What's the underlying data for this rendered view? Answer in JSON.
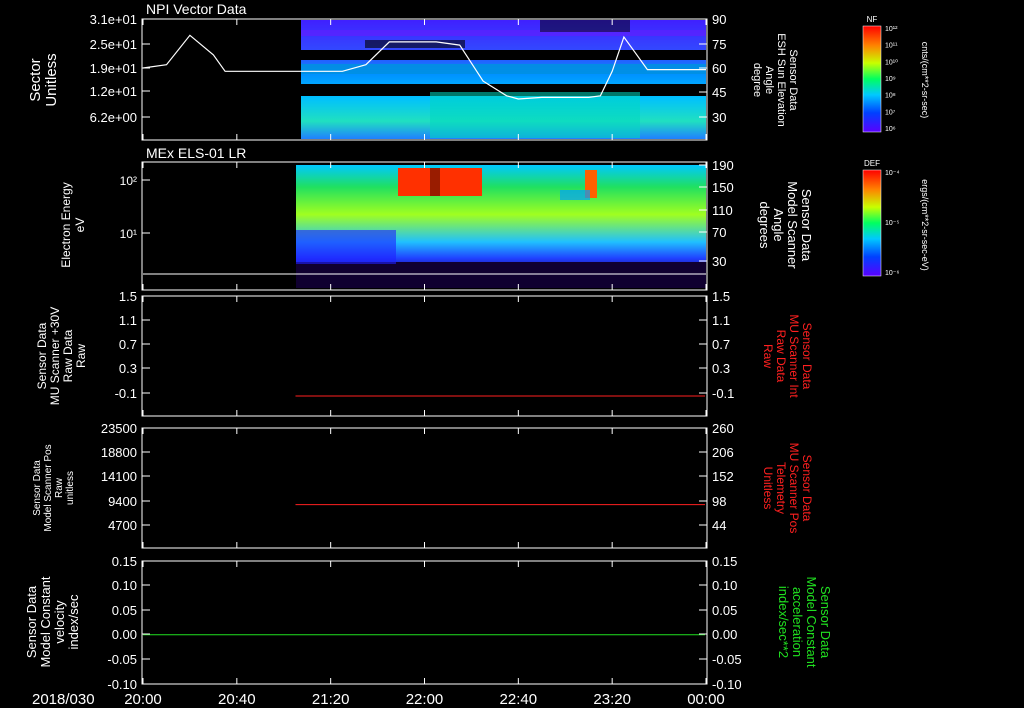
{
  "x_axis": {
    "date_label": "2018/030",
    "tick_labels": [
      "20:00",
      "20:40",
      "21:20",
      "22:00",
      "22:40",
      "23:20",
      "00:00"
    ]
  },
  "colors": {
    "white": "#ffffff",
    "red": "#ff2020",
    "green": "#20e020"
  },
  "panels": [
    {
      "title": "NPI Vector Data",
      "left_label": [
        "Sector",
        "Unitless"
      ],
      "left_ticks": [
        "3.1e+01",
        "2.5e+01",
        "1.9e+01",
        "1.2e+01",
        "6.2e+00"
      ],
      "right_label": [
        "Sensor Data",
        "ESH Sun Elevation",
        "Angle",
        "degree"
      ],
      "right_ticks": [
        "90",
        "75",
        "60",
        "45",
        "30"
      ],
      "colorbar": {
        "label": "NF",
        "units": "cnts/(cm**2-sr-sec)",
        "ticks": [
          "10¹²",
          "10¹¹",
          "10¹⁰",
          "10⁹",
          "10⁸",
          "10⁷",
          "10⁶"
        ]
      }
    },
    {
      "title": "MEx ELS-01 LR",
      "left_label": [
        "Electron Energy",
        "eV"
      ],
      "left_ticks": [
        "10²",
        "10¹"
      ],
      "right_label": [
        "Sensor Data",
        "Model Scanner",
        "Angle",
        "degrees"
      ],
      "right_ticks": [
        "190",
        "150",
        "110",
        "70",
        "30"
      ],
      "colorbar": {
        "label": "DEF",
        "units": "ergs/(cm**2-sr-sec-eV)",
        "ticks": [
          "10⁻⁴",
          "10⁻⁵",
          "10⁻⁶"
        ]
      }
    },
    {
      "left_label": [
        "Sensor Data",
        "MU Scanner +30V",
        "Raw Data",
        "Raw"
      ],
      "left_ticks": [
        "1.5",
        "1.1",
        "0.7",
        "0.3",
        "-0.1"
      ],
      "right_label": [
        "Sensor Data",
        "MU Scanner Int",
        "Raw Data",
        "Raw"
      ],
      "right_ticks": [
        "1.5",
        "1.1",
        "0.7",
        "0.3",
        "-0.1"
      ]
    },
    {
      "left_label": [
        "Sensor Data",
        "Model Scanner Pos",
        "Raw",
        "unitless"
      ],
      "left_ticks": [
        "23500",
        "18800",
        "14100",
        "9400",
        "4700"
      ],
      "right_label": [
        "Sensor Data",
        "MU Scanner Pos",
        "Telemetry",
        "Unitless"
      ],
      "right_ticks": [
        "260",
        "206",
        "152",
        "98",
        "44"
      ]
    },
    {
      "left_label": [
        "Sensor Data",
        "Model Constant",
        "velocity",
        "index/sec"
      ],
      "left_ticks": [
        "0.15",
        "0.10",
        "0.05",
        "0.00",
        "-0.05",
        "-0.10"
      ],
      "right_label": [
        "Sensor Data",
        "Model Constant",
        "acceleration",
        "index/sec**2"
      ],
      "right_ticks": [
        "0.15",
        "0.10",
        "0.05",
        "0.00",
        "-0.05",
        "-0.10"
      ]
    }
  ],
  "chart_data": [
    {
      "type": "heatmap",
      "title": "NPI Vector Data",
      "x_range": [
        "20:00",
        "00:00"
      ],
      "ylabel": "Sector Unitless",
      "y_ticks": [
        "3.1e+01",
        "2.5e+01",
        "1.9e+01",
        "1.2e+01",
        "6.2e+00"
      ],
      "data_start": "21:10",
      "overlay_line": {
        "label": "Sensor Data ESH Sun Elevation Angle degree",
        "x": [
          "20:00",
          "20:10",
          "20:20",
          "20:30",
          "20:35",
          "20:45",
          "20:55",
          "21:10",
          "21:25",
          "21:35",
          "21:45",
          "21:55",
          "22:05",
          "22:15",
          "22:25",
          "22:35",
          "22:40",
          "22:50",
          "23:00",
          "23:10",
          "23:15",
          "23:20",
          "23:25",
          "23:35",
          "00:00"
        ],
        "y": [
          60,
          62,
          80,
          68,
          58,
          58,
          58,
          58,
          58,
          62,
          76,
          76,
          76,
          74,
          52,
          43,
          41,
          42,
          42,
          42,
          43,
          58,
          79,
          59,
          59
        ]
      }
    },
    {
      "type": "heatmap",
      "title": "MEx ELS-01 LR",
      "x_range": [
        "20:00",
        "00:00"
      ],
      "ylabel": "Electron Energy eV",
      "data_start": "21:07",
      "overlay_line": {
        "label": "Sensor Data Model Scanner Angle degrees",
        "x": [
          "20:00",
          "00:00"
        ],
        "y": [
          10,
          10
        ]
      }
    },
    {
      "type": "line",
      "x_range": [
        "20:00",
        "00:00"
      ],
      "ylim": [
        -0.3,
        1.5
      ],
      "series": [
        {
          "color": "#ff2020",
          "x": [
            "21:05",
            "00:00"
          ],
          "y": [
            0,
            0
          ]
        }
      ]
    },
    {
      "type": "line",
      "x_range": [
        "20:00",
        "00:00"
      ],
      "ylim": [
        0,
        23500
      ],
      "series": [
        {
          "color": "#ff2020",
          "x": [
            "21:05",
            "00:00"
          ],
          "y": [
            8500,
            8500
          ]
        }
      ]
    },
    {
      "type": "line",
      "x_range": [
        "20:00",
        "00:00"
      ],
      "ylim": [
        -0.1,
        0.15
      ],
      "series": [
        {
          "color": "#20e020",
          "x": [
            "20:00",
            "00:00"
          ],
          "y": [
            0,
            0
          ]
        }
      ]
    }
  ]
}
